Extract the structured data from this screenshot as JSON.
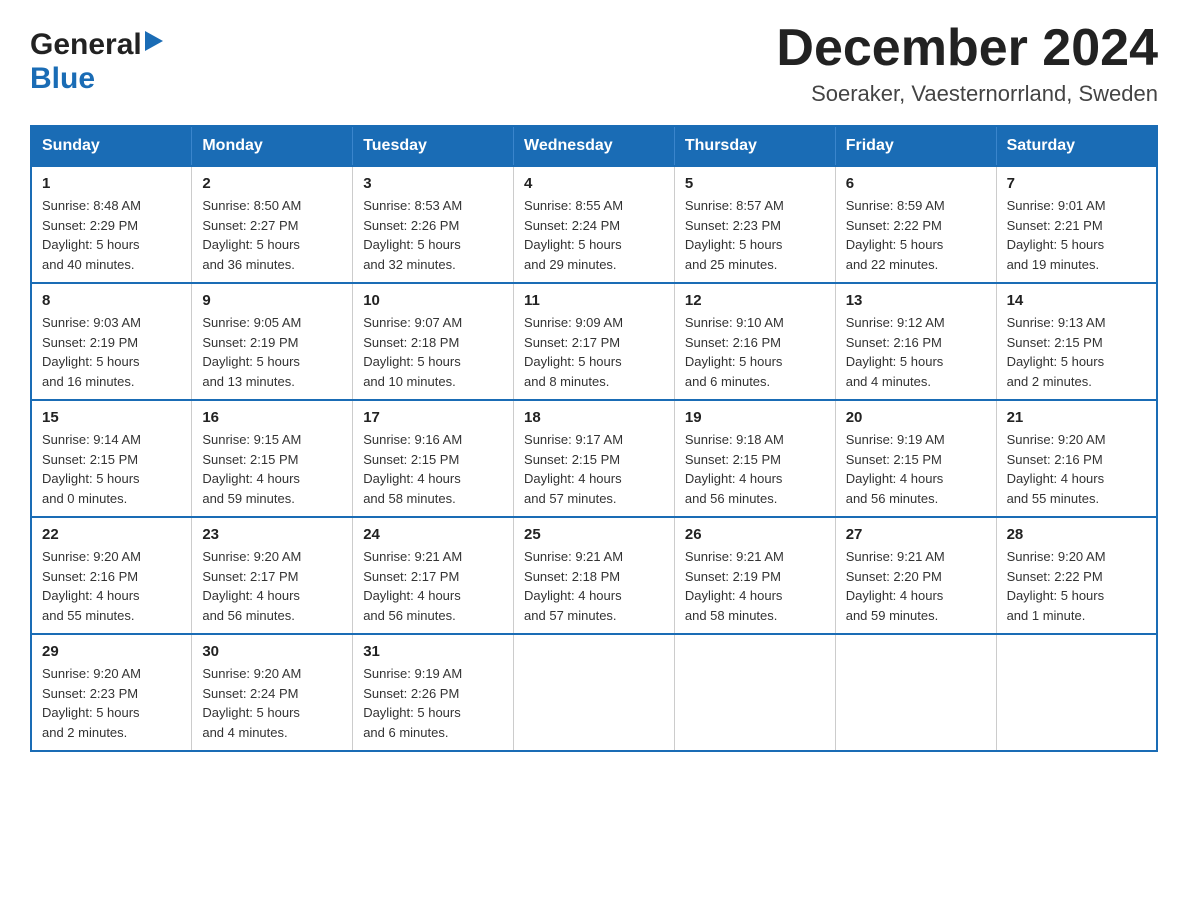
{
  "logo": {
    "general": "General",
    "blue": "Blue"
  },
  "title": "December 2024",
  "subtitle": "Soeraker, Vaesternorrland, Sweden",
  "days_of_week": [
    "Sunday",
    "Monday",
    "Tuesday",
    "Wednesday",
    "Thursday",
    "Friday",
    "Saturday"
  ],
  "weeks": [
    [
      {
        "day": "1",
        "sunrise": "8:48 AM",
        "sunset": "2:29 PM",
        "daylight": "5 hours and 40 minutes."
      },
      {
        "day": "2",
        "sunrise": "8:50 AM",
        "sunset": "2:27 PM",
        "daylight": "5 hours and 36 minutes."
      },
      {
        "day": "3",
        "sunrise": "8:53 AM",
        "sunset": "2:26 PM",
        "daylight": "5 hours and 32 minutes."
      },
      {
        "day": "4",
        "sunrise": "8:55 AM",
        "sunset": "2:24 PM",
        "daylight": "5 hours and 29 minutes."
      },
      {
        "day": "5",
        "sunrise": "8:57 AM",
        "sunset": "2:23 PM",
        "daylight": "5 hours and 25 minutes."
      },
      {
        "day": "6",
        "sunrise": "8:59 AM",
        "sunset": "2:22 PM",
        "daylight": "5 hours and 22 minutes."
      },
      {
        "day": "7",
        "sunrise": "9:01 AM",
        "sunset": "2:21 PM",
        "daylight": "5 hours and 19 minutes."
      }
    ],
    [
      {
        "day": "8",
        "sunrise": "9:03 AM",
        "sunset": "2:19 PM",
        "daylight": "5 hours and 16 minutes."
      },
      {
        "day": "9",
        "sunrise": "9:05 AM",
        "sunset": "2:19 PM",
        "daylight": "5 hours and 13 minutes."
      },
      {
        "day": "10",
        "sunrise": "9:07 AM",
        "sunset": "2:18 PM",
        "daylight": "5 hours and 10 minutes."
      },
      {
        "day": "11",
        "sunrise": "9:09 AM",
        "sunset": "2:17 PM",
        "daylight": "5 hours and 8 minutes."
      },
      {
        "day": "12",
        "sunrise": "9:10 AM",
        "sunset": "2:16 PM",
        "daylight": "5 hours and 6 minutes."
      },
      {
        "day": "13",
        "sunrise": "9:12 AM",
        "sunset": "2:16 PM",
        "daylight": "5 hours and 4 minutes."
      },
      {
        "day": "14",
        "sunrise": "9:13 AM",
        "sunset": "2:15 PM",
        "daylight": "5 hours and 2 minutes."
      }
    ],
    [
      {
        "day": "15",
        "sunrise": "9:14 AM",
        "sunset": "2:15 PM",
        "daylight": "5 hours and 0 minutes."
      },
      {
        "day": "16",
        "sunrise": "9:15 AM",
        "sunset": "2:15 PM",
        "daylight": "4 hours and 59 minutes."
      },
      {
        "day": "17",
        "sunrise": "9:16 AM",
        "sunset": "2:15 PM",
        "daylight": "4 hours and 58 minutes."
      },
      {
        "day": "18",
        "sunrise": "9:17 AM",
        "sunset": "2:15 PM",
        "daylight": "4 hours and 57 minutes."
      },
      {
        "day": "19",
        "sunrise": "9:18 AM",
        "sunset": "2:15 PM",
        "daylight": "4 hours and 56 minutes."
      },
      {
        "day": "20",
        "sunrise": "9:19 AM",
        "sunset": "2:15 PM",
        "daylight": "4 hours and 56 minutes."
      },
      {
        "day": "21",
        "sunrise": "9:20 AM",
        "sunset": "2:16 PM",
        "daylight": "4 hours and 55 minutes."
      }
    ],
    [
      {
        "day": "22",
        "sunrise": "9:20 AM",
        "sunset": "2:16 PM",
        "daylight": "4 hours and 55 minutes."
      },
      {
        "day": "23",
        "sunrise": "9:20 AM",
        "sunset": "2:17 PM",
        "daylight": "4 hours and 56 minutes."
      },
      {
        "day": "24",
        "sunrise": "9:21 AM",
        "sunset": "2:17 PM",
        "daylight": "4 hours and 56 minutes."
      },
      {
        "day": "25",
        "sunrise": "9:21 AM",
        "sunset": "2:18 PM",
        "daylight": "4 hours and 57 minutes."
      },
      {
        "day": "26",
        "sunrise": "9:21 AM",
        "sunset": "2:19 PM",
        "daylight": "4 hours and 58 minutes."
      },
      {
        "day": "27",
        "sunrise": "9:21 AM",
        "sunset": "2:20 PM",
        "daylight": "4 hours and 59 minutes."
      },
      {
        "day": "28",
        "sunrise": "9:20 AM",
        "sunset": "2:22 PM",
        "daylight": "5 hours and 1 minute."
      }
    ],
    [
      {
        "day": "29",
        "sunrise": "9:20 AM",
        "sunset": "2:23 PM",
        "daylight": "5 hours and 2 minutes."
      },
      {
        "day": "30",
        "sunrise": "9:20 AM",
        "sunset": "2:24 PM",
        "daylight": "5 hours and 4 minutes."
      },
      {
        "day": "31",
        "sunrise": "9:19 AM",
        "sunset": "2:26 PM",
        "daylight": "5 hours and 6 minutes."
      },
      null,
      null,
      null,
      null
    ]
  ],
  "labels": {
    "sunrise": "Sunrise:",
    "sunset": "Sunset:",
    "daylight": "Daylight:"
  }
}
